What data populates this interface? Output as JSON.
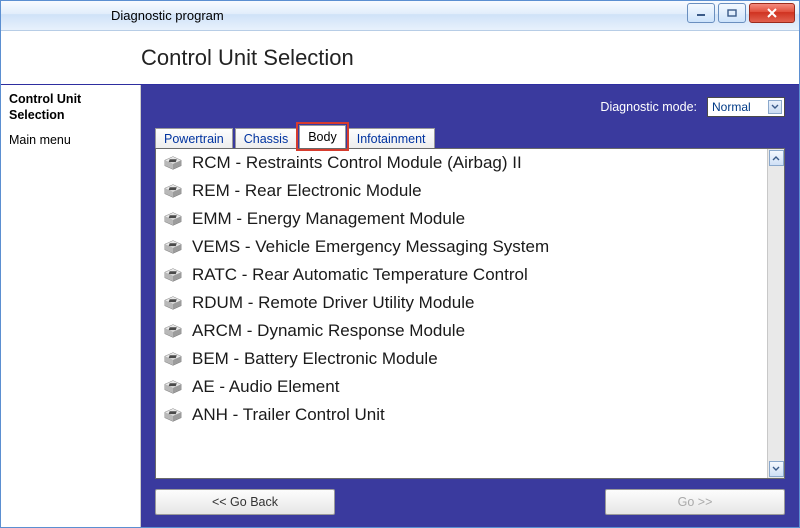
{
  "titlebar": {
    "title": "Diagnostic program"
  },
  "header": {
    "title": "Control Unit Selection"
  },
  "sidebar": {
    "items": [
      {
        "label": "Control Unit Selection",
        "bold": true
      },
      {
        "label": "Main menu",
        "bold": false
      }
    ]
  },
  "mode": {
    "label": "Diagnostic mode:",
    "selected": "Normal"
  },
  "tabs": [
    {
      "label": "Powertrain",
      "active": false
    },
    {
      "label": "Chassis",
      "active": false
    },
    {
      "label": "Body",
      "active": true,
      "highlight": true
    },
    {
      "label": "Infotainment",
      "active": false
    }
  ],
  "modules": [
    {
      "label": "RCM - Restraints Control Module (Airbag) II"
    },
    {
      "label": "REM - Rear Electronic Module"
    },
    {
      "label": "EMM - Energy Management Module"
    },
    {
      "label": "VEMS - Vehicle Emergency Messaging System"
    },
    {
      "label": "RATC - Rear Automatic Temperature Control"
    },
    {
      "label": "RDUM - Remote Driver Utility Module"
    },
    {
      "label": "ARCM - Dynamic Response Module"
    },
    {
      "label": "BEM - Battery Electronic Module"
    },
    {
      "label": "AE - Audio Element"
    },
    {
      "label": "ANH - Trailer Control Unit"
    }
  ],
  "buttons": {
    "back": "<< Go Back",
    "go": "Go >>"
  }
}
